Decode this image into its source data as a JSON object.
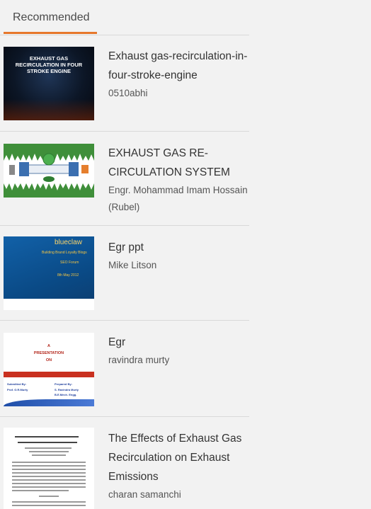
{
  "tabs": {
    "recommended_label": "Recommended"
  },
  "colors": {
    "accent": "#e6782c",
    "separator": "#d9d9d9",
    "background": "#f2f2f2"
  },
  "items": [
    {
      "title": "Exhaust gas-recirculation-in-four-stroke-engine",
      "author": "0510abhi",
      "thumb_text": [
        "EXHAUST GAS",
        "RECIRCULATION IN FOUR",
        "STROKE ENGINE"
      ]
    },
    {
      "title": "EXHAUST GAS RE-CIRCULATION SYSTEM",
      "author": "Engr. Mohammad Imam Hossain (Rubel)"
    },
    {
      "title": "Egr ppt",
      "author": "Mike Litson",
      "thumb_text": [
        "blueclaw",
        "Building Brand Loyalty Blogs",
        "SEO Forum",
        "8th May 2012"
      ]
    },
    {
      "title": "Egr",
      "author": "ravindra murty",
      "thumb_text": [
        "A",
        "PRESENTATION",
        "ON",
        "Submitted By:",
        "Prof. G.R.Murty",
        "Prepared By:",
        "S. Ravindra Murty",
        "B.E.Mech. Engg."
      ]
    },
    {
      "title": "The Effects of Exhaust Gas Recirculation on Exhaust Emissions",
      "author": "charan samanchi"
    }
  ]
}
